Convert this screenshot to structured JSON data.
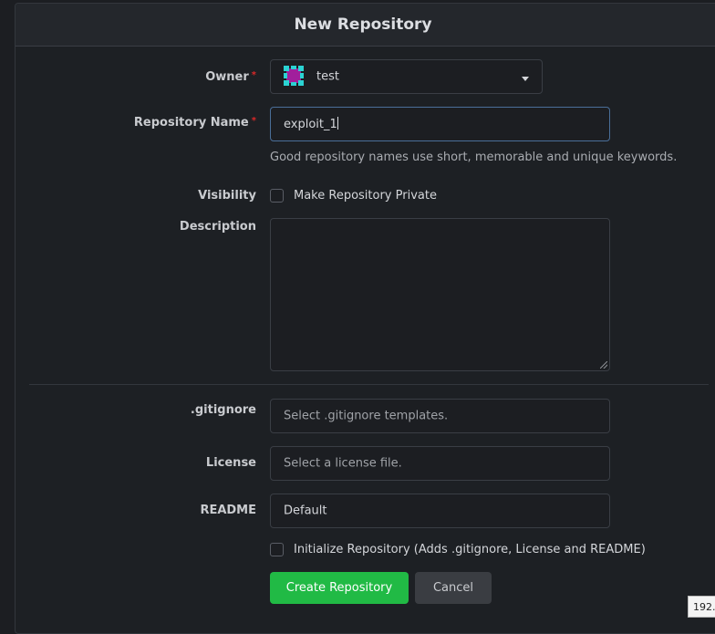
{
  "form": {
    "title": "New Repository",
    "owner": {
      "label": "Owner",
      "value": "test"
    },
    "repo_name": {
      "label": "Repository Name",
      "value": "exploit_1",
      "help": "Good repository names use short, memorable and unique keywords."
    },
    "visibility": {
      "label": "Visibility",
      "checkbox_label": "Make Repository Private",
      "checked": false
    },
    "description": {
      "label": "Description",
      "value": ""
    },
    "gitignore": {
      "label": ".gitignore",
      "placeholder": "Select .gitignore templates."
    },
    "license": {
      "label": "License",
      "placeholder": "Select a license file."
    },
    "readme": {
      "label": "README",
      "value": "Default"
    },
    "init": {
      "checkbox_label": "Initialize Repository (Adds .gitignore, License and README)",
      "checked": false
    },
    "buttons": {
      "create": "Create Repository",
      "cancel": "Cancel"
    },
    "required_marker": "*"
  },
  "status_tip": "192.",
  "colors": {
    "accent_green": "#21ba45",
    "required_red": "#db2828",
    "focus_border": "#4a6f99",
    "avatar_primary": "#a11f9c",
    "avatar_secondary": "#2bd3d3"
  }
}
